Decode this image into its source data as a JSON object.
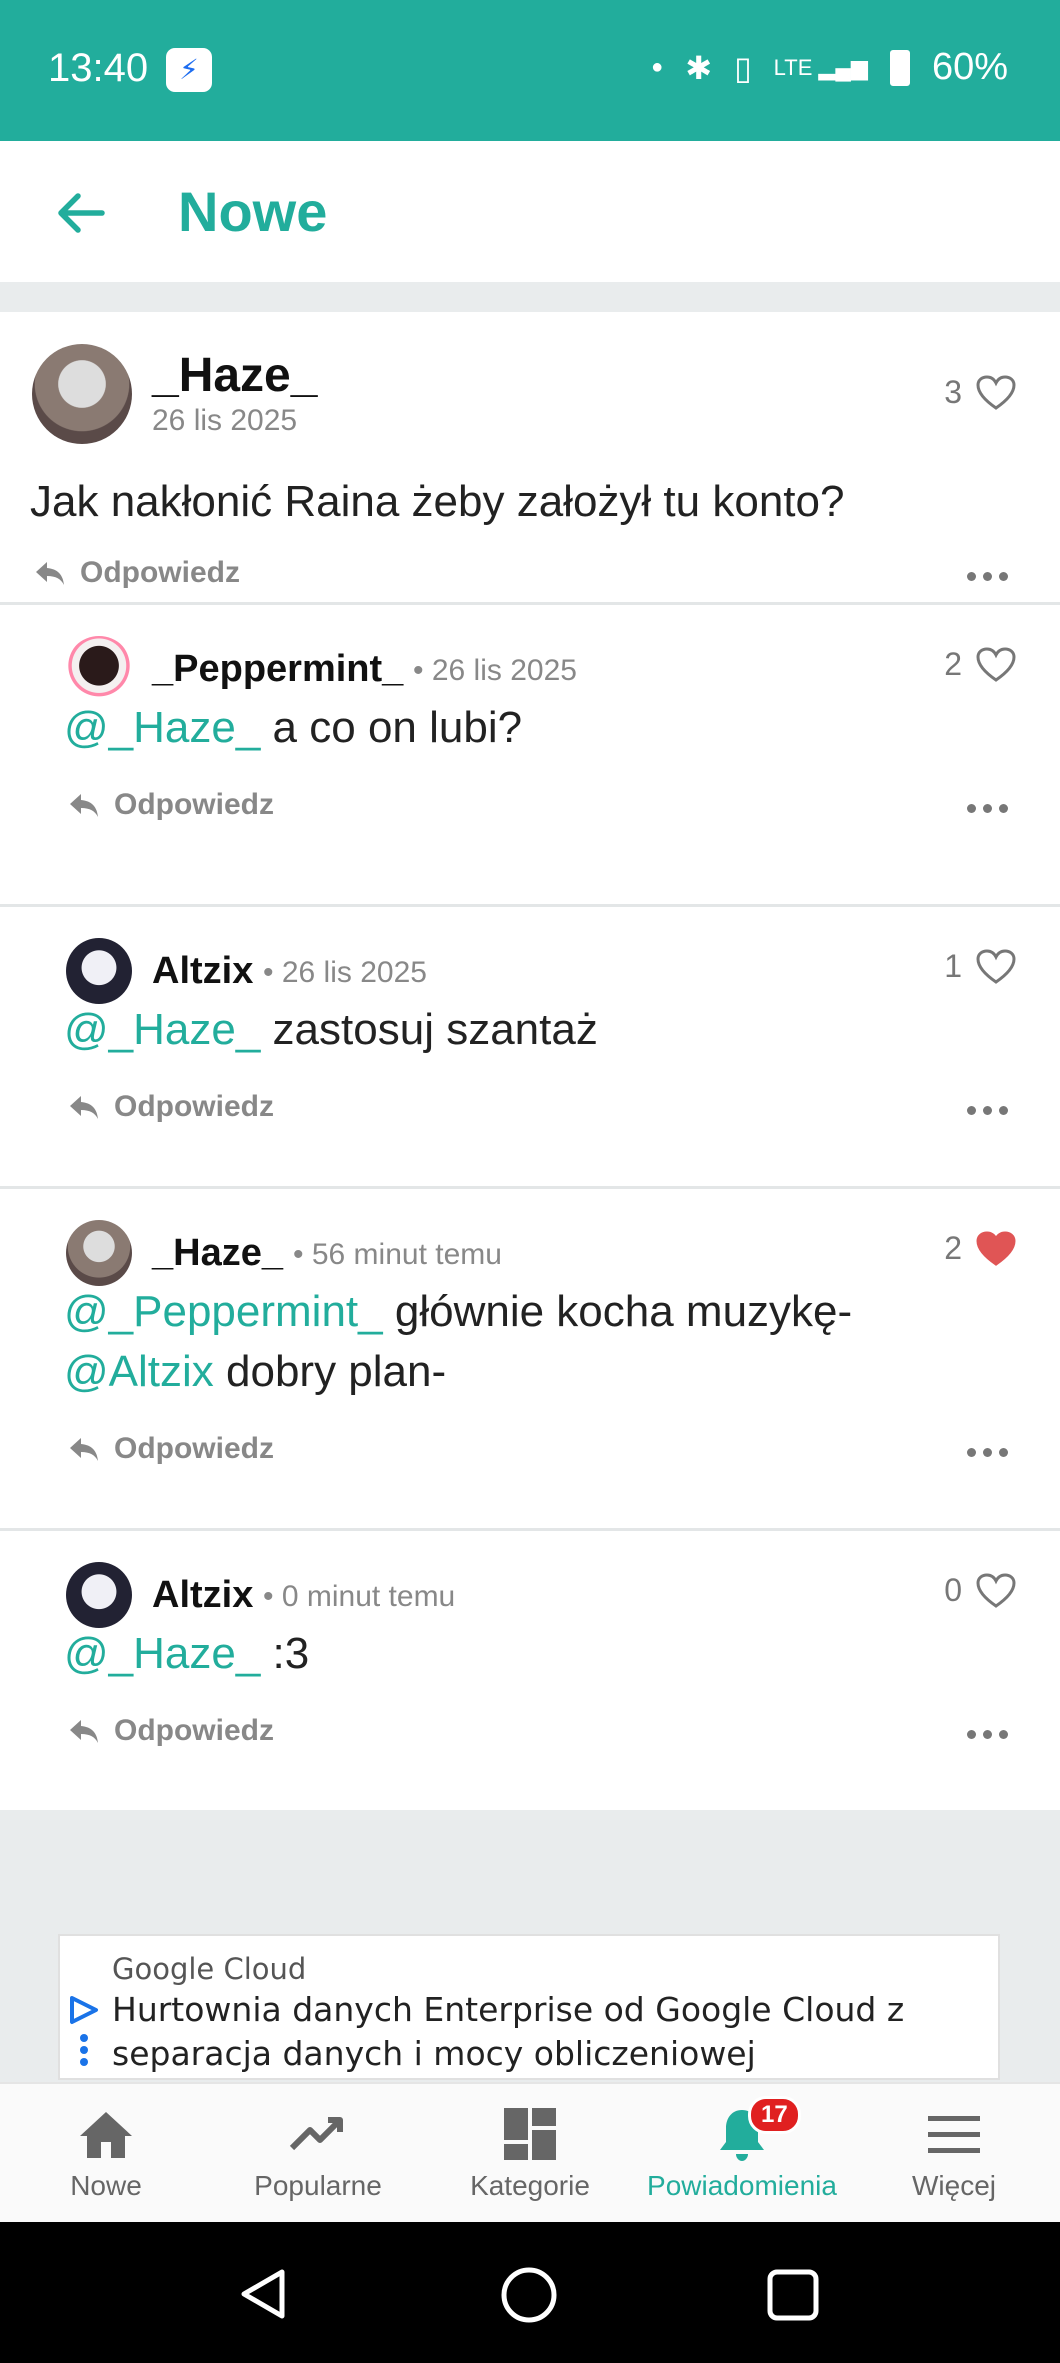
{
  "status_bar": {
    "time": "13:40",
    "battery": "60%"
  },
  "header": {
    "title": "Nowe"
  },
  "main_post": {
    "author": "_Haze_",
    "date": "26 lis 2025",
    "likes": "3",
    "text": "Jak nakłonić Raina żeby założył tu konto?",
    "reply_label": "Odpowiedz"
  },
  "replies": [
    {
      "author": "_Peppermint_",
      "date": "• 26 lis 2025",
      "likes": "2",
      "liked": false,
      "lines": [
        {
          "mention": "@_Haze_",
          "text": " a co on lubi?"
        }
      ],
      "reply_label": "Odpowiedz"
    },
    {
      "author": "Altzix",
      "date": "• 26 lis 2025",
      "likes": "1",
      "liked": false,
      "lines": [
        {
          "mention": "@_Haze_",
          "text": " zastosuj szantaż"
        }
      ],
      "reply_label": "Odpowiedz"
    },
    {
      "author": "_Haze_",
      "date": "• 56 minut temu",
      "likes": "2",
      "liked": true,
      "lines": [
        {
          "mention": "@_Peppermint_",
          "text": " głównie kocha muzykę-"
        },
        {
          "mention": "@Altzix",
          "text": " dobry plan-"
        }
      ],
      "reply_label": "Odpowiedz"
    },
    {
      "author": "Altzix",
      "date": "• 0 minut temu",
      "likes": "0",
      "liked": false,
      "lines": [
        {
          "mention": "@_Haze_",
          "text": " :3"
        }
      ],
      "reply_label": "Odpowiedz"
    }
  ],
  "ad": {
    "brand": "Google Cloud",
    "line1": "Hurtownia danych Enterprise od Google Cloud z",
    "line2": "separacja danych i mocy obliczeniowej"
  },
  "bottom_nav": {
    "items": [
      {
        "label": "Nowe",
        "icon": "home-icon"
      },
      {
        "label": "Popularne",
        "icon": "trending-icon"
      },
      {
        "label": "Kategorie",
        "icon": "grid-icon"
      },
      {
        "label": "Powiadomienia",
        "icon": "bell-icon",
        "badge": "17",
        "active": true
      },
      {
        "label": "Więcej",
        "icon": "menu-icon"
      }
    ]
  },
  "colors": {
    "accent": "#22ad9c",
    "liked": "#e05555"
  }
}
